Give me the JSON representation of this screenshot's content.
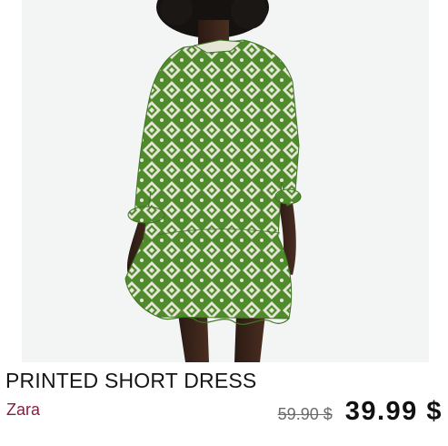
{
  "product": {
    "title": "PRINTED SHORT DRESS",
    "brand": "Zara",
    "old_price": "59.90 $",
    "price": "39.99 $"
  },
  "image": {
    "subject": "green and white geometric printed short dress",
    "background_color": "#f3f4f4",
    "dress_green": "#4f8a2c",
    "print_white": "#e6e6d6"
  },
  "colors": {
    "brand_color": "#8d1b43",
    "title_color": "#151515",
    "old_price_color": "#6b6b6b"
  }
}
